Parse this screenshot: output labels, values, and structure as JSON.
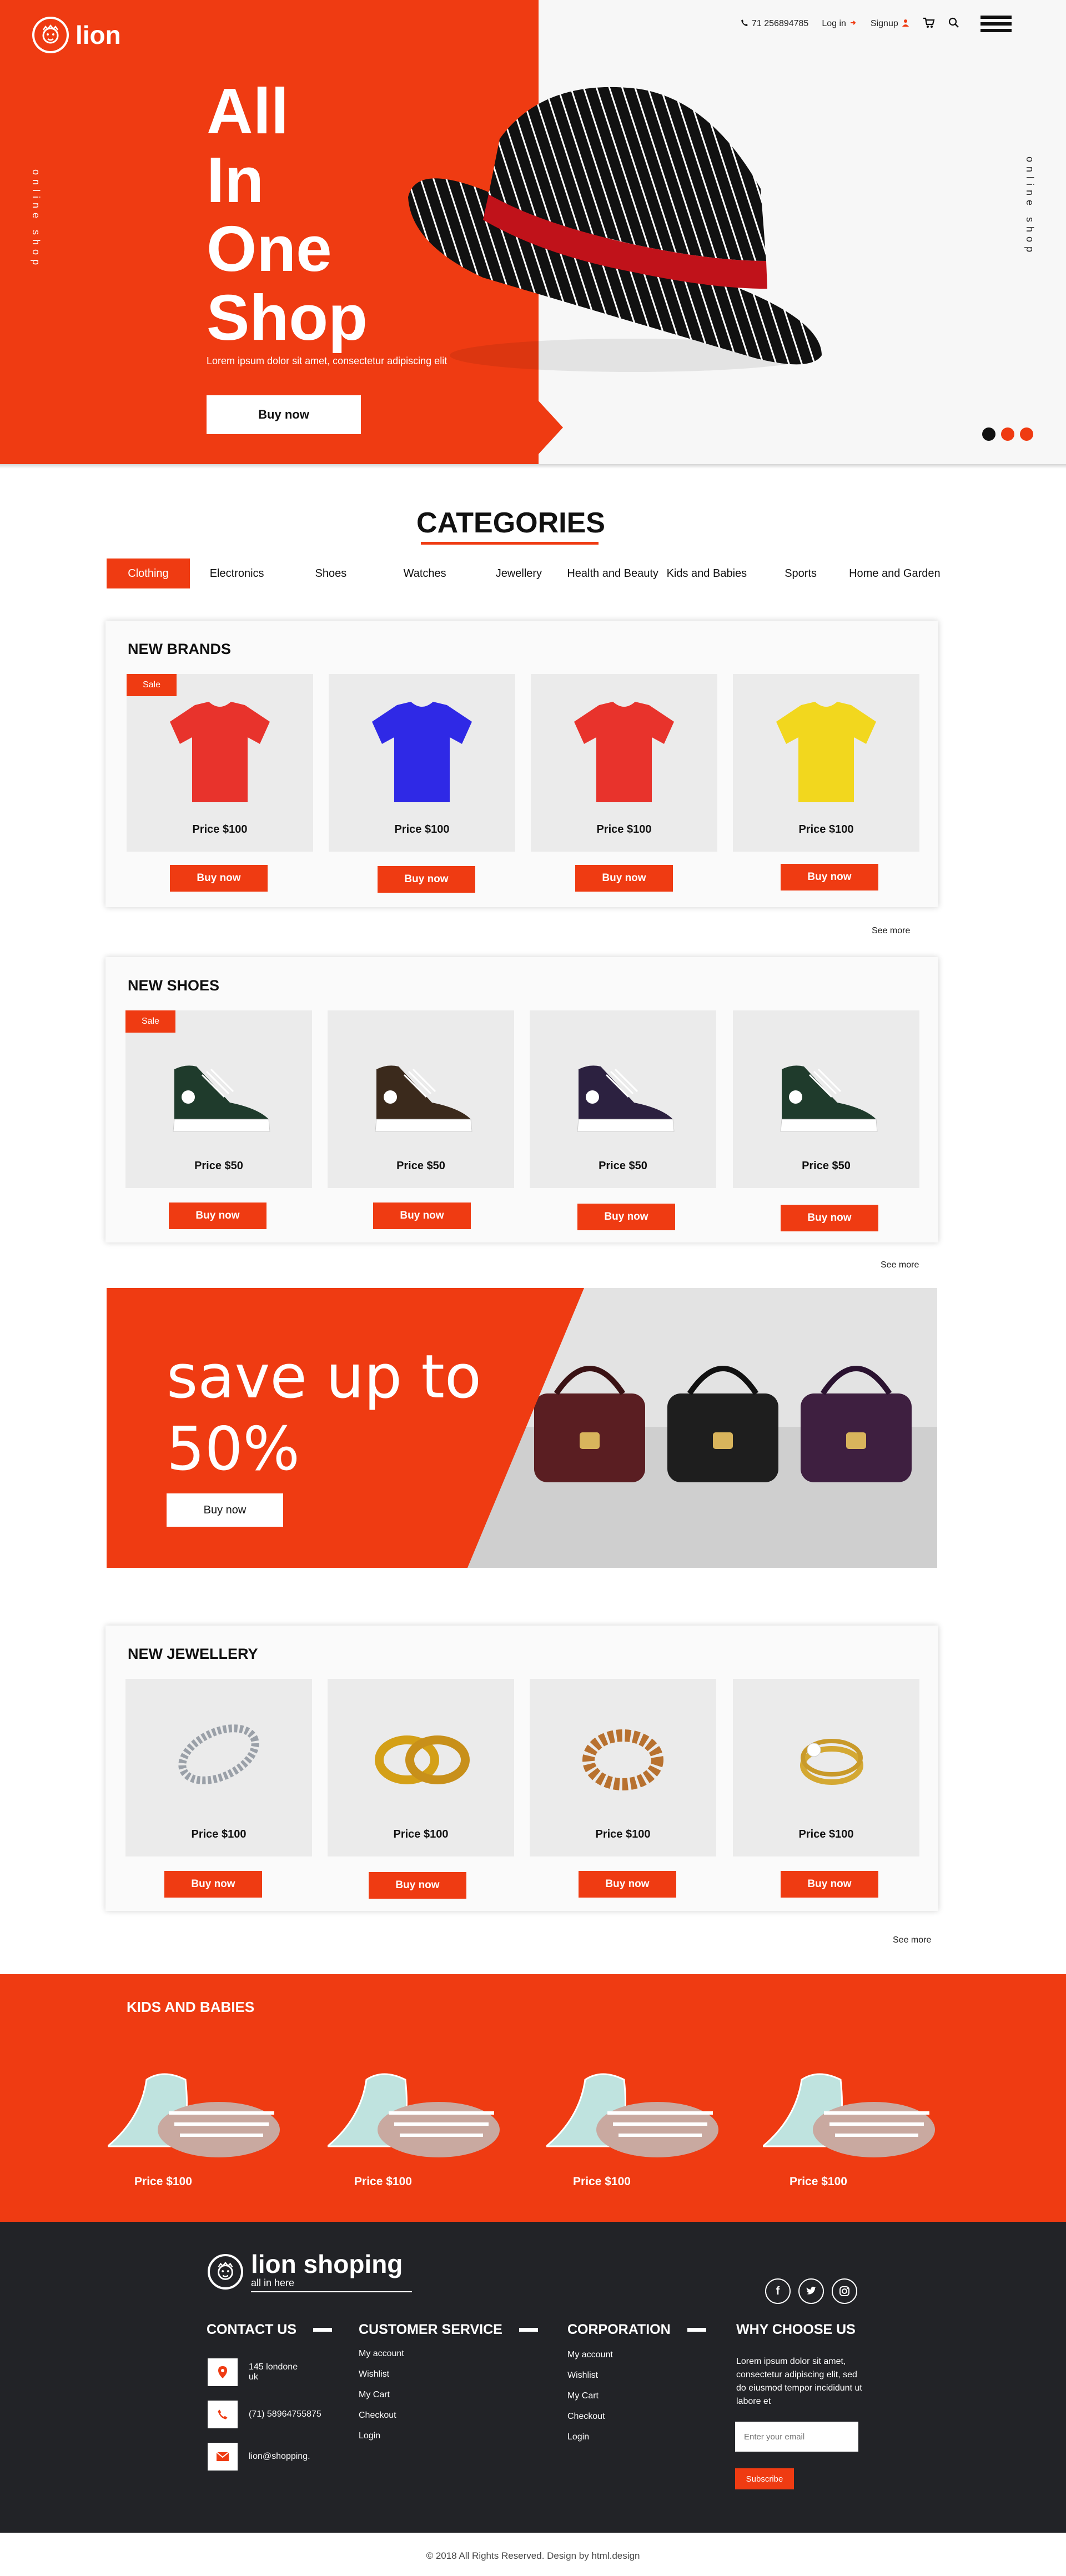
{
  "colors": {
    "accent": "#ef3b12",
    "footer_bg": "#222327",
    "card_bg": "#ebebeb"
  },
  "header": {
    "brand": "lion",
    "phone": "71 256894785",
    "login": "Log in",
    "signup": "Signup",
    "side_text": "online shop",
    "icons": [
      "phone-icon",
      "login-icon",
      "user-icon",
      "cart-icon",
      "search-icon",
      "menu-icon"
    ]
  },
  "hero": {
    "title_lines": [
      "All",
      "In",
      "One",
      "Shop"
    ],
    "subtitle": "Lorem ipsum dolor sit amet, consectetur adipiscing elit",
    "button": "Buy now"
  },
  "categories": {
    "title": "CATEGORIES",
    "tabs": [
      "Clothing",
      "Electronics",
      "Shoes",
      "Watches",
      "Jewellery",
      "Health and Beauty",
      "Kids and Babies",
      "Sports",
      "Home and Garden"
    ],
    "active": "Clothing"
  },
  "sale_label": "Sale",
  "buy_label": "Buy now",
  "see_more": "See more",
  "new_brands": {
    "title": "NEW BRANDS",
    "products": [
      {
        "price": "Price $100",
        "color": "#e8332c"
      },
      {
        "price": "Price $100",
        "color": "#2f29e6"
      },
      {
        "price": "Price $100",
        "color": "#e8332c"
      },
      {
        "price": "Price $100",
        "color": "#f2d71e"
      }
    ]
  },
  "new_shoes": {
    "title": "NEW SHOES",
    "products": [
      {
        "price": "Price $50",
        "color": "#1f3b2c"
      },
      {
        "price": "Price $50",
        "color": "#3b2a1c"
      },
      {
        "price": "Price $50",
        "color": "#2c2140"
      },
      {
        "price": "Price $50",
        "color": "#1f3b2c"
      }
    ]
  },
  "promo": {
    "line1": "save up to",
    "line2": "50%",
    "button": "Buy now"
  },
  "new_jewellery": {
    "title": "NEW JEWELLERY",
    "products": [
      {
        "price": "Price $100"
      },
      {
        "price": "Price $100"
      },
      {
        "price": "Price $100"
      },
      {
        "price": "Price $100"
      }
    ]
  },
  "kids": {
    "title": "KIDS AND BABIES",
    "products": [
      {
        "price": "Price $100"
      },
      {
        "price": "Price $100"
      },
      {
        "price": "Price $100"
      },
      {
        "price": "Price $100"
      }
    ]
  },
  "footer": {
    "brand": "lion shoping",
    "tagline": "all in here",
    "contact": {
      "title": "CONTACT US",
      "address": "145 londone\nuk",
      "phone": "(71) 58964755875",
      "email": "lion@shopping."
    },
    "customer_service": {
      "title": "CUSTOMER SERVICE",
      "links": [
        "My account",
        "Wishlist",
        "My Cart",
        "Checkout",
        "Login"
      ]
    },
    "corporation": {
      "title": "CORPORATION",
      "links": [
        "My account",
        "Wishlist",
        "My Cart",
        "Checkout",
        "Login"
      ]
    },
    "why": {
      "title": "WHY CHOOSE US",
      "text": "Lorem ipsum dolor sit amet, consectetur adipiscing elit, sed do eiusmod tempor incididunt ut labore et",
      "email_placeholder": "Enter your email",
      "subscribe": "Subscribe"
    },
    "social": [
      "facebook-icon",
      "twitter-icon",
      "instagram-icon"
    ],
    "copyright": "© 2018 All Rights Reserved. Design by html.design"
  }
}
